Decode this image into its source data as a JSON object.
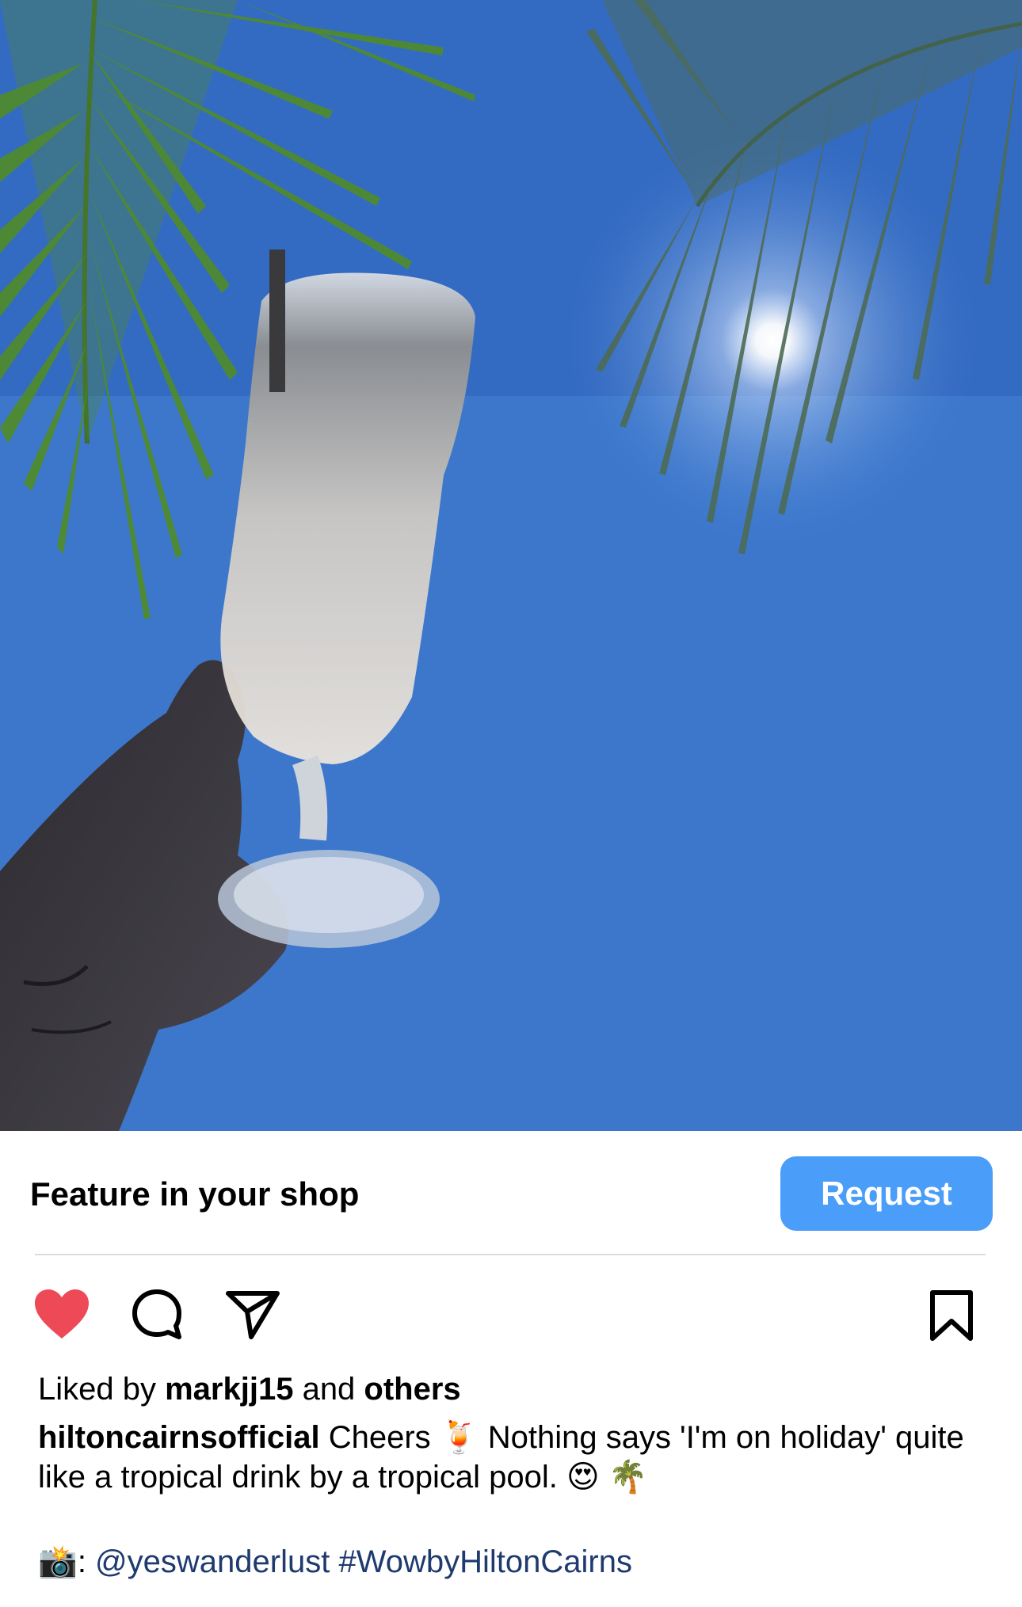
{
  "post": {
    "image_alt": "Hand raising a frozen cocktail glass against a blue sky with palm fronds and sun",
    "colors": {
      "sky": "#3c77cc",
      "accent_button": "#4a9df8",
      "heart": "#ed4956",
      "link": "#1e3a6e"
    }
  },
  "shop": {
    "label": "Feature in your shop",
    "button_label": "Request"
  },
  "actions": {
    "like_icon": "heart-filled-icon",
    "comment_icon": "comment-icon",
    "share_icon": "paper-plane-icon",
    "save_icon": "bookmark-icon"
  },
  "likes": {
    "prefix": "Liked by ",
    "user": "markjj15",
    "middle": " and ",
    "others": "others"
  },
  "caption": {
    "username": "hiltoncairnsofficial",
    "text_part1": " Cheers ",
    "emoji1": "🍹",
    "text_part2": " Nothing says 'I'm on holiday' quite like a tropical drink by a tropical pool. ",
    "emoji2": "😍",
    "emoji3": "🌴"
  },
  "credit": {
    "camera_emoji": "📸",
    "separator": ": ",
    "mention": "@yeswanderlust",
    "space": " ",
    "hashtag": "#WowbyHiltonCairns"
  }
}
